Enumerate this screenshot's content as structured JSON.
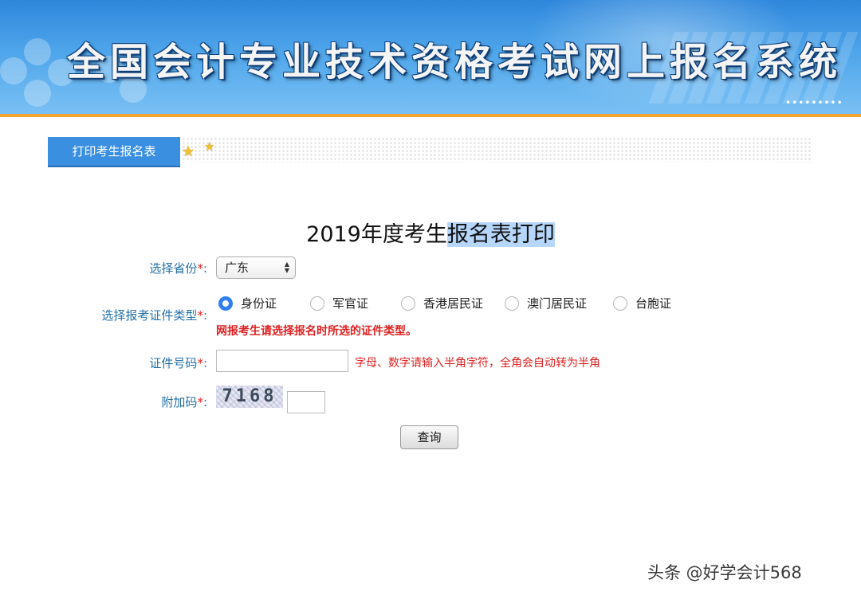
{
  "banner": {
    "title": "全国会计专业技术资格考试网上报名系统"
  },
  "tab": {
    "label": "打印考生报名表"
  },
  "form": {
    "title_plain": "2019年度考生",
    "title_highlighted": "报名表打印",
    "province": {
      "label": "选择省份",
      "required_mark": "*",
      "colon": ":",
      "selected": "广东"
    },
    "id_type": {
      "label": "选择报考证件类型",
      "required_mark": "*",
      "colon": ":",
      "options": [
        "身份证",
        "军官证",
        "香港居民证",
        "澳门居民证",
        "台胞证"
      ],
      "selected_index": 0,
      "note": "网报考生请选择报名时所选的证件类型。"
    },
    "id_number": {
      "label": "证件号码",
      "required_mark": "*",
      "colon": ":",
      "value": "",
      "hint": "字母、数字请输入半角字符，全角会自动转为半角"
    },
    "captcha": {
      "label": "附加码",
      "required_mark": "*",
      "colon": ":",
      "image_text": "7168",
      "value": ""
    },
    "query_button": "查询"
  },
  "watermark": "头条 @好学会计568",
  "colors": {
    "banner_blue": "#3a8fe0",
    "orange_line": "#f3a42c",
    "label_blue": "#2470a8",
    "required_red": "#e02020",
    "highlight": "#b6d7fb"
  },
  "icons": [
    "star-icon",
    "select-arrows-icon"
  ]
}
